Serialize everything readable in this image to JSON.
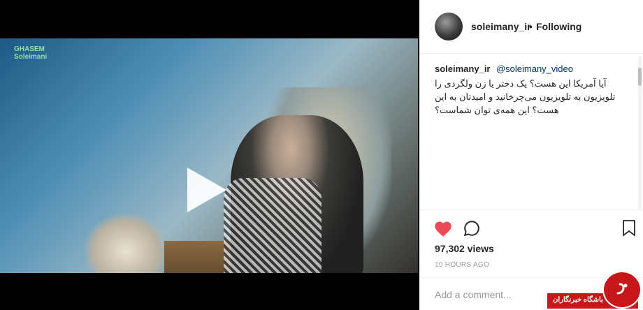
{
  "video": {
    "watermark_line1": "GHASEM",
    "watermark_line2": "Soleimani"
  },
  "header": {
    "username": "soleimany_ir",
    "separator": "•",
    "follow_label": "Following"
  },
  "caption": {
    "username": "soleimany_ir",
    "mention": "@soleimany_video",
    "text": "آیا آمریکا این هست؟ یک دختر یا زن ولگردی را تلویزیون به تلویزیون می‌چرخانید و امیدتان به این هست؟ این همه‌ی توان شماست؟"
  },
  "stats": {
    "views": "97,302 views",
    "time": "10 HOURS AGO"
  },
  "comment": {
    "placeholder": "Add a comment..."
  },
  "badge": {
    "text": "باشگاه خبرنگاران"
  },
  "icons": {
    "play": "play-icon",
    "like": "heart-icon",
    "comment": "comment-icon",
    "save": "bookmark-icon",
    "more": "more-icon"
  },
  "colors": {
    "like_red": "#ed4956",
    "badge_red": "#c8171b",
    "link_blue": "#003569"
  }
}
